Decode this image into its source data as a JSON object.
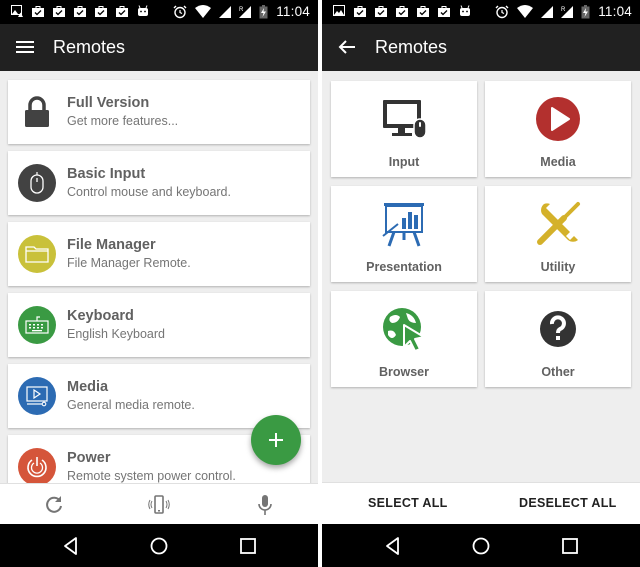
{
  "status_bar": {
    "time": "11:04",
    "notification_icons": [
      "image-alert-icon",
      "shopping-bag-check-icon",
      "shopping-bag-check-icon",
      "shopping-bag-check-icon",
      "shopping-bag-check-icon",
      "shopping-bag-check-icon",
      "android-icon"
    ],
    "system_icons": [
      "alarm-icon",
      "wifi-icon",
      "cell-signal-icon",
      "roaming-signal-icon",
      "battery-charging-icon"
    ],
    "roaming_label": "R"
  },
  "left_screen": {
    "app_bar": {
      "title": "Remotes",
      "nav_icon": "hamburger-menu-icon"
    },
    "remotes": [
      {
        "title": "Full Version",
        "subtitle": "Get more features...",
        "icon": "lock-icon",
        "color": "#424242"
      },
      {
        "title": "Basic Input",
        "subtitle": "Control mouse and keyboard.",
        "icon": "mouse-icon",
        "color": "#424242"
      },
      {
        "title": "File Manager",
        "subtitle": "File Manager Remote.",
        "icon": "folder-icon",
        "color": "#c9c13a"
      },
      {
        "title": "Keyboard",
        "subtitle": "English Keyboard",
        "icon": "keyboard-icon",
        "color": "#3a9a43"
      },
      {
        "title": "Media",
        "subtitle": "General media remote.",
        "icon": "media-screen-icon",
        "color": "#2c6bb3"
      },
      {
        "title": "Power",
        "subtitle": "Remote system power control.",
        "icon": "power-icon",
        "color": "#d5553a"
      }
    ],
    "fab": {
      "icon": "plus-icon",
      "color": "#3a9a43"
    },
    "bottom_bar": [
      "refresh-icon",
      "phone-vibrate-icon",
      "microphone-icon"
    ]
  },
  "right_screen": {
    "app_bar": {
      "title": "Remotes",
      "nav_icon": "back-arrow-icon"
    },
    "categories": [
      {
        "label": "Input",
        "icon": "monitor-mouse-icon",
        "color": "#333333"
      },
      {
        "label": "Media",
        "icon": "play-circle-icon",
        "color": "#b3302e"
      },
      {
        "label": "Presentation",
        "icon": "presentation-board-icon",
        "color": "#2c6bb3"
      },
      {
        "label": "Utility",
        "icon": "tools-icon",
        "color": "#d4b12a"
      },
      {
        "label": "Browser",
        "icon": "globe-cursor-icon",
        "color": "#3a9a43"
      },
      {
        "label": "Other",
        "icon": "question-circle-icon",
        "color": "#333333"
      }
    ],
    "actions": {
      "select_all": "SELECT ALL",
      "deselect_all": "DESELECT ALL"
    }
  },
  "nav_bar": [
    "back-triangle-icon",
    "home-circle-icon",
    "recents-square-icon"
  ]
}
